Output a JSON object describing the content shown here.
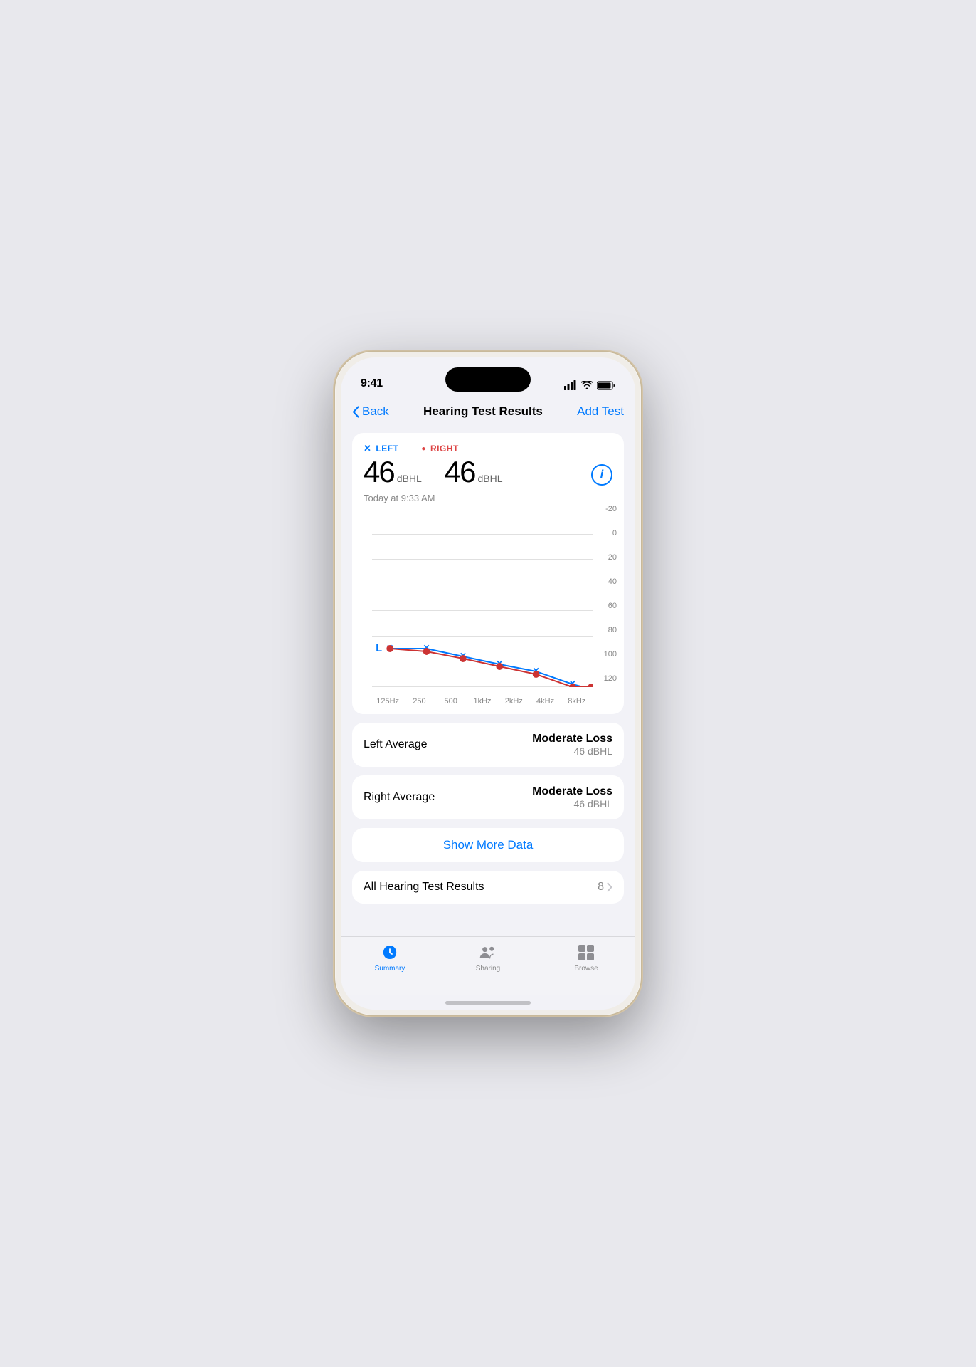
{
  "status_bar": {
    "time": "9:41"
  },
  "nav": {
    "back_label": "Back",
    "title": "Hearing Test Results",
    "action_label": "Add Test"
  },
  "results": {
    "left_label": "LEFT",
    "right_label": "RIGHT",
    "left_value": "46",
    "right_value": "46",
    "unit": "dBHL",
    "timestamp": "Today at 9:33 AM"
  },
  "chart": {
    "y_labels": [
      "-20",
      "0",
      "20",
      "40",
      "60",
      "80",
      "100",
      "120"
    ],
    "x_labels": [
      "125Hz",
      "250",
      "500",
      "1kHz",
      "2kHz",
      "4kHz",
      "8kHz"
    ]
  },
  "left_average": {
    "label": "Left Average",
    "classification": "Moderate Loss",
    "value": "46 dBHL"
  },
  "right_average": {
    "label": "Right Average",
    "classification": "Moderate Loss",
    "value": "46 dBHL"
  },
  "show_more": {
    "label": "Show More Data"
  },
  "all_results": {
    "label": "All Hearing Test Results",
    "count": "8"
  },
  "tab_bar": {
    "tabs": [
      {
        "id": "summary",
        "label": "Summary",
        "active": true
      },
      {
        "id": "sharing",
        "label": "Sharing",
        "active": false
      },
      {
        "id": "browse",
        "label": "Browse",
        "active": false
      }
    ]
  }
}
